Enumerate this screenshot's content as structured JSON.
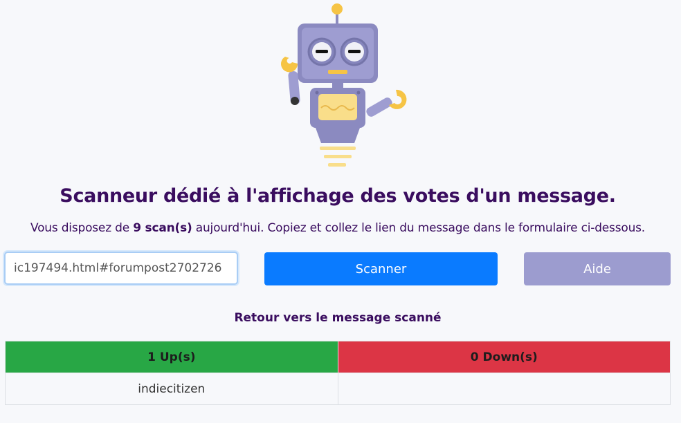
{
  "header": {
    "title": "Scanneur dédié à l'affichage des votes d'un message.",
    "subtitle_prefix": "Vous disposez de ",
    "scan_count": "9 scan(s)",
    "subtitle_suffix": " aujourd'hui. Copiez et collez le lien du message dans le formulaire ci-dessous."
  },
  "form": {
    "url_value": "ic197494.html#forumpost2702726",
    "scan_button": "Scanner",
    "help_button": "Aide"
  },
  "back_link": "Retour vers le message scanné",
  "votes": {
    "up_header": "1 Up(s)",
    "down_header": "0 Down(s)",
    "up_users": [
      "indiecitizen"
    ],
    "down_users": [
      ""
    ]
  },
  "colors": {
    "primary": "#0a7bff",
    "help": "#9c9ccf",
    "up": "#28a745",
    "down": "#dc3545",
    "text": "#3a0d5f"
  }
}
